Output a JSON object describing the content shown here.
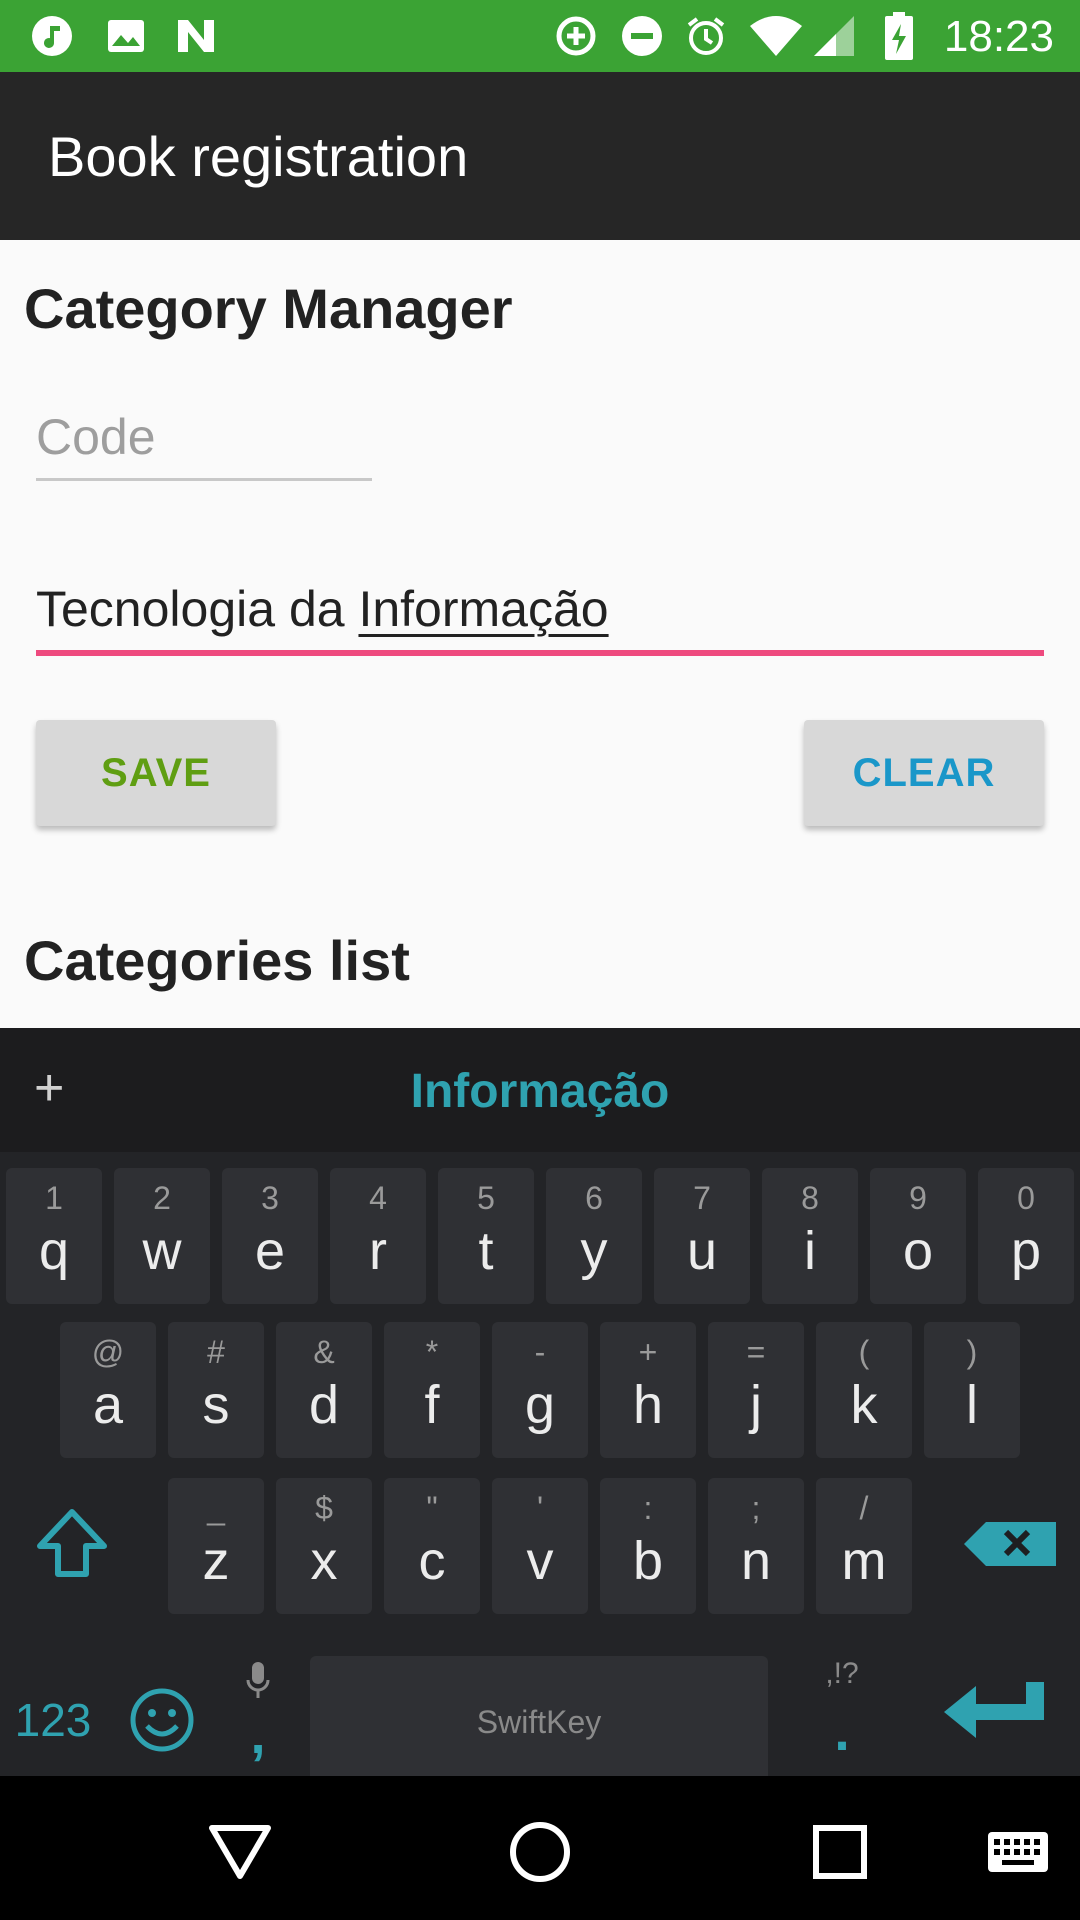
{
  "status_bar": {
    "time": "18:23",
    "left_icons": [
      "music-icon",
      "image-icon",
      "n-icon"
    ],
    "right_icons": [
      "data-saver-icon",
      "do-not-disturb-icon",
      "alarm-icon",
      "wifi-icon",
      "signal-icon",
      "battery-charging-icon"
    ]
  },
  "app_bar": {
    "title": "Book registration"
  },
  "manager": {
    "title": "Category Manager",
    "code_placeholder": "Code",
    "name_prefix": "Tecnologia da ",
    "name_composing": "Informação"
  },
  "buttons": {
    "save_label": "SAVE",
    "clear_label": "CLEAR"
  },
  "list": {
    "title": "Categories list"
  },
  "keyboard": {
    "suggestion": "Informação",
    "row1": [
      {
        "sec": "1",
        "key": "q"
      },
      {
        "sec": "2",
        "key": "w"
      },
      {
        "sec": "3",
        "key": "e"
      },
      {
        "sec": "4",
        "key": "r"
      },
      {
        "sec": "5",
        "key": "t"
      },
      {
        "sec": "6",
        "key": "y"
      },
      {
        "sec": "7",
        "key": "u"
      },
      {
        "sec": "8",
        "key": "i"
      },
      {
        "sec": "9",
        "key": "o"
      },
      {
        "sec": "0",
        "key": "p"
      }
    ],
    "row2": [
      {
        "sec": "@",
        "key": "a"
      },
      {
        "sec": "#",
        "key": "s"
      },
      {
        "sec": "&",
        "key": "d"
      },
      {
        "sec": "*",
        "key": "f"
      },
      {
        "sec": "-",
        "key": "g"
      },
      {
        "sec": "+",
        "key": "h"
      },
      {
        "sec": "=",
        "key": "j"
      },
      {
        "sec": "(",
        "key": "k"
      },
      {
        "sec": ")",
        "key": "l"
      }
    ],
    "row3": [
      {
        "sec": "_",
        "key": "z"
      },
      {
        "sec": "$",
        "key": "x"
      },
      {
        "sec": "\"",
        "key": "c"
      },
      {
        "sec": "'",
        "key": "v"
      },
      {
        "sec": ":",
        "key": "b"
      },
      {
        "sec": ";",
        "key": "n"
      },
      {
        "sec": "/",
        "key": "m"
      }
    ],
    "numbers_label": "123",
    "comma_label": ",",
    "period_label": ".",
    "punct_hint": ",!?",
    "space_brand": "SwiftKey"
  },
  "colors": {
    "status_bar": "#3ba334",
    "app_bar": "#262626",
    "field_focus": "#ee4a7e",
    "save_text": "#5f9e12",
    "clear_text": "#1a97c9",
    "keyboard_accent": "#2fa2b0"
  }
}
